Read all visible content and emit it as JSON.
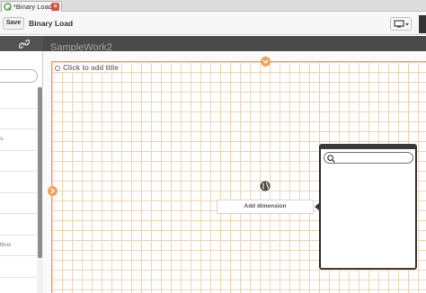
{
  "tab": {
    "title": "*Binary Load",
    "icon": "qlik-app-icon",
    "close_icon": "close-icon",
    "close_symbol": "×"
  },
  "toolbar": {
    "save_label": "Save",
    "app_title": "Binary Load",
    "device_icon": "device-preview-icon"
  },
  "left_panel": {
    "header_icon": "link-icon",
    "rows": [
      {
        "label": ""
      },
      {
        "label": ""
      },
      {
        "label": "s"
      },
      {
        "label": ""
      },
      {
        "label": ""
      },
      {
        "label": ""
      },
      {
        "label": ""
      },
      {
        "label": "tbox"
      },
      {
        "label": ""
      },
      {
        "label": ""
      }
    ]
  },
  "sheet": {
    "name": "SampleWork2",
    "add_title": "Click to add title",
    "add_dimension": "Add dimension"
  },
  "popover": {
    "search_placeholder": ""
  },
  "colors": {
    "accent": "#f0a35e",
    "close": "#d9533f",
    "dark": "#4a4a4a"
  }
}
